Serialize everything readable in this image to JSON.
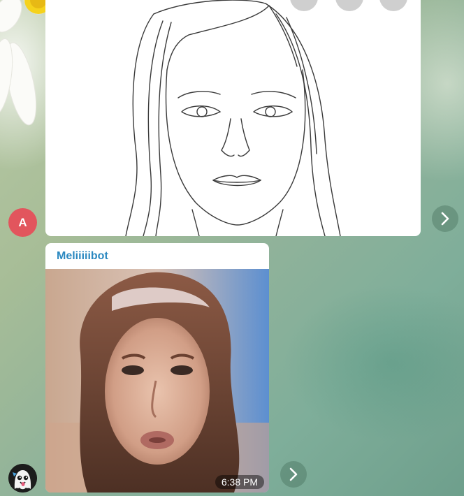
{
  "messages": [
    {
      "sender_initial": "A",
      "type": "photo",
      "content": "line-drawing-face"
    },
    {
      "sender": "Meliiiiibot",
      "type": "photo",
      "content": "generated-face-photo",
      "time": "6:38 PM"
    }
  ],
  "icons": {
    "forward": "chevron-right-icon",
    "bot_avatar": "ghost-avatar-icon"
  },
  "colors": {
    "avatar_a": "#e2555d",
    "sender_name": "#2a88c0",
    "bubble": "#ffffff"
  }
}
